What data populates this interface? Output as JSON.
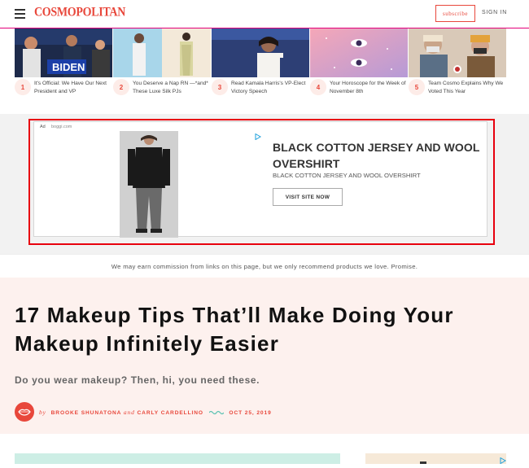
{
  "header": {
    "logo": "COSMOPOLITAN",
    "subscribe_label": "subscribe",
    "signin_label": "SIGN IN"
  },
  "trending": [
    {
      "number": "1",
      "title": "It's Official: We Have Our Next President and VP"
    },
    {
      "number": "2",
      "title": "You Deserve a Nap RN —*and* These Luxe Silk PJs"
    },
    {
      "number": "3",
      "title": "Read Kamala Harris's VP-Elect Victory Speech"
    },
    {
      "number": "4",
      "title": "Your Horoscope for the Week of November 8th"
    },
    {
      "number": "5",
      "title": "Team Cosmo Explains Why We Voted This Year"
    }
  ],
  "ad": {
    "label": "Ad",
    "domain": "boggi.com",
    "title": "BLACK COTTON JERSEY AND WOOL OVERSHIRT",
    "subtitle": "BLACK COTTON JERSEY AND WOOL OVERSHIRT",
    "cta": "VISIT SITE NOW"
  },
  "disclaimer": "We may earn commission from links on this page, but we only recommend products we love. Promise.",
  "article": {
    "headline": "17 Makeup Tips That’ll Make Doing Your Makeup Infinitely Easier",
    "dek": "Do you wear makeup? Then, hi, you need these.",
    "byline_by": "by",
    "author1": "BROOKE SHUNATONA",
    "byline_and": "and",
    "author2": "CARLY CARDELLINO",
    "date": "OCT 25, 2019"
  },
  "colors": {
    "brand": "#e8473b",
    "hero_bg": "#fdf1ee",
    "highlight_border": "#e8000e"
  }
}
